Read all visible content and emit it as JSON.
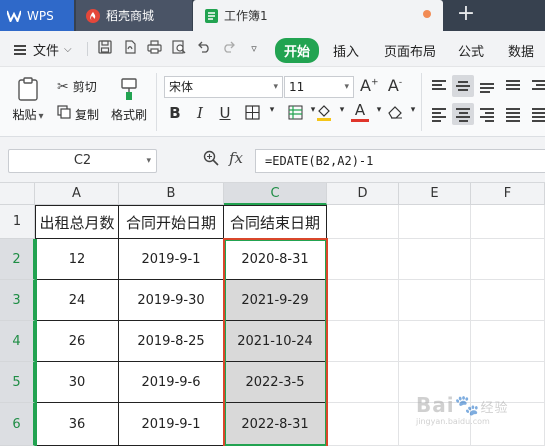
{
  "tabs": {
    "wps": "WPS",
    "store": "稻壳商城",
    "doc": "工作簿1",
    "add_icon": "plus"
  },
  "menu": {
    "file": "文件",
    "tabs": [
      "开始",
      "插入",
      "页面布局",
      "公式",
      "数据"
    ],
    "active_tab": "开始"
  },
  "ribbon": {
    "paste": "粘贴",
    "cut": "剪切",
    "copy": "复制",
    "format_painter": "格式刷",
    "font_name": "宋体",
    "font_size": "11",
    "grow_font": "A",
    "shrink_font": "A",
    "bold": "B",
    "italic": "I",
    "underline": "U",
    "font_color_letter": "A"
  },
  "formula_bar": {
    "name_box": "C2",
    "fx": "fx",
    "formula": "=EDATE(B2,A2)-1"
  },
  "sheet": {
    "columns": [
      "A",
      "B",
      "C",
      "D",
      "E",
      "F"
    ],
    "selected_column": "C",
    "rows": [
      "1",
      "2",
      "3",
      "4",
      "5",
      "6"
    ],
    "header": [
      "出租总月数",
      "合同开始日期",
      "合同结束日期"
    ],
    "data": [
      [
        "12",
        "2019-9-1",
        "2020-8-31"
      ],
      [
        "24",
        "2019-9-30",
        "2021-9-29"
      ],
      [
        "26",
        "2019-8-25",
        "2021-10-24"
      ],
      [
        "30",
        "2019-9-6",
        "2022-3-5"
      ],
      [
        "36",
        "2019-9-1",
        "2022-8-31"
      ]
    ]
  },
  "watermark": {
    "brand": "Bai",
    "brand_tail": "经验",
    "sub": "jingyan.baidu.com"
  },
  "colors": {
    "accent_green": "#22a351",
    "highlight_red": "#d9472b",
    "wps_blue": "#2f69c9"
  }
}
